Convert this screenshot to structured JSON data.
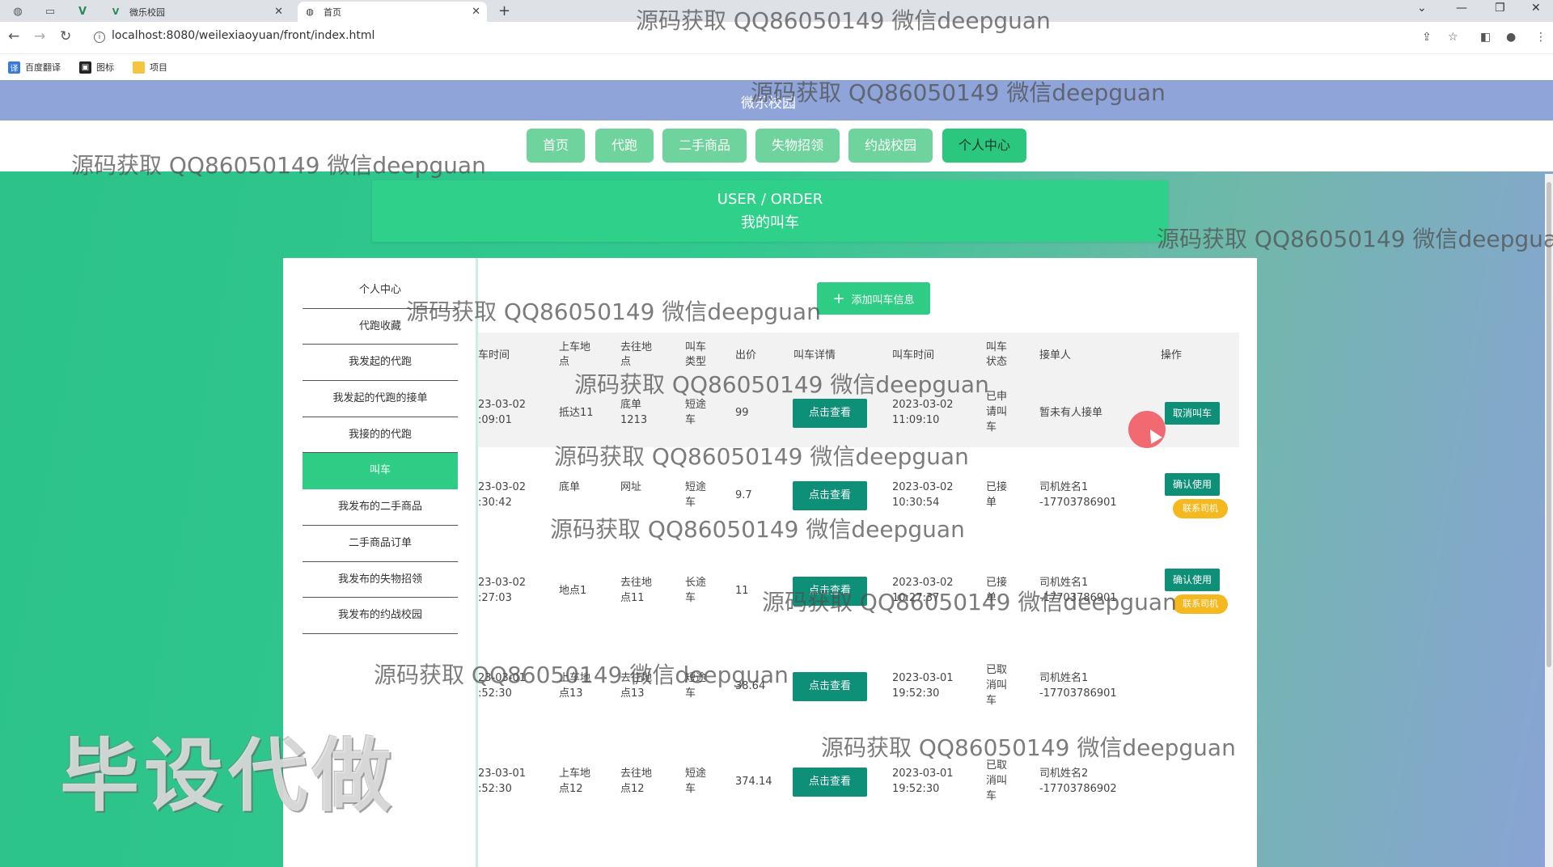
{
  "browser": {
    "tabs": [
      {
        "title": "微乐校园",
        "active": false
      },
      {
        "title": "首页",
        "active": true
      }
    ],
    "url": "localhost:8080/weilexiaoyuan/front/index.html",
    "bookmarks": [
      "百度翻译",
      "图标",
      "项目"
    ]
  },
  "site": {
    "title": "微乐校园",
    "nav": [
      "首页",
      "代跑",
      "二手商品",
      "失物招领",
      "约战校园",
      "个人中心"
    ],
    "active_nav": "个人中心"
  },
  "banner": {
    "line1": "USER / ORDER",
    "line2": "我的叫车"
  },
  "sidebar": {
    "items": [
      "个人中心",
      "代跑收藏",
      "我发起的代跑",
      "我发起的代跑的接单",
      "我接的的代跑",
      "叫车",
      "我发布的二手商品",
      "二手商品订单",
      "我发布的失物招领",
      "我发布的约战校园"
    ],
    "active": "叫车"
  },
  "add_button": "添加叫车信息",
  "table": {
    "headers": [
      "车时间",
      "上车地点",
      "去往地点",
      "叫车类型",
      "出价",
      "叫车详情",
      "叫车时间",
      "叫车状态",
      "接单人",
      "操作"
    ],
    "rows": [
      {
        "time": "23-03-02 :09:01",
        "from": "抵达11",
        "to": "底单1213",
        "type": "短途车",
        "price": "99",
        "detail": "点击查看",
        "call_time": "2023-03-02 11:09:10",
        "status": "已申请叫车",
        "driver": "暂未有人接单",
        "ops": [
          "取消叫车"
        ]
      },
      {
        "time": "23-03-02 :30:42",
        "from": "底单",
        "to": "网址",
        "type": "短途车",
        "price": "9.7",
        "detail": "点击查看",
        "call_time": "2023-03-02 10:30:54",
        "status": "已接单",
        "driver": "司机姓名1 -17703786901",
        "ops": [
          "确认使用",
          "联系司机"
        ]
      },
      {
        "time": "23-03-02 :27:03",
        "from": "地点1",
        "to": "去往地点11",
        "type": "长途车",
        "price": "11",
        "detail": "点击查看",
        "call_time": "2023-03-02 10:27:37",
        "status": "已接单",
        "driver": "司机姓名1 -17703786901",
        "ops": [
          "确认使用",
          "联系司机"
        ]
      },
      {
        "time": "23-03-01 :52:30",
        "from": "上车地点13",
        "to": "去往地点13",
        "type": "短途车",
        "price": "38.64",
        "detail": "点击查看",
        "call_time": "2023-03-01 19:52:30",
        "status": "已取消叫车",
        "driver": "司机姓名1 -17703786901",
        "ops": []
      },
      {
        "time": "23-03-01 :52:30",
        "from": "上车地点12",
        "to": "去往地点12",
        "type": "短途车",
        "price": "374.14",
        "detail": "点击查看",
        "call_time": "2023-03-01 19:52:30",
        "status": "已取消叫车",
        "driver": "司机姓名2 -17703786902",
        "ops": []
      }
    ]
  },
  "watermark": "源码获取 QQ86050149 微信deepguan",
  "big_watermark": "毕设代做",
  "colors": {
    "header": "#8fa4d9",
    "primary": "#2ecc84",
    "button_dark": "#0e8f78",
    "button_yellow": "#f5b81e"
  }
}
